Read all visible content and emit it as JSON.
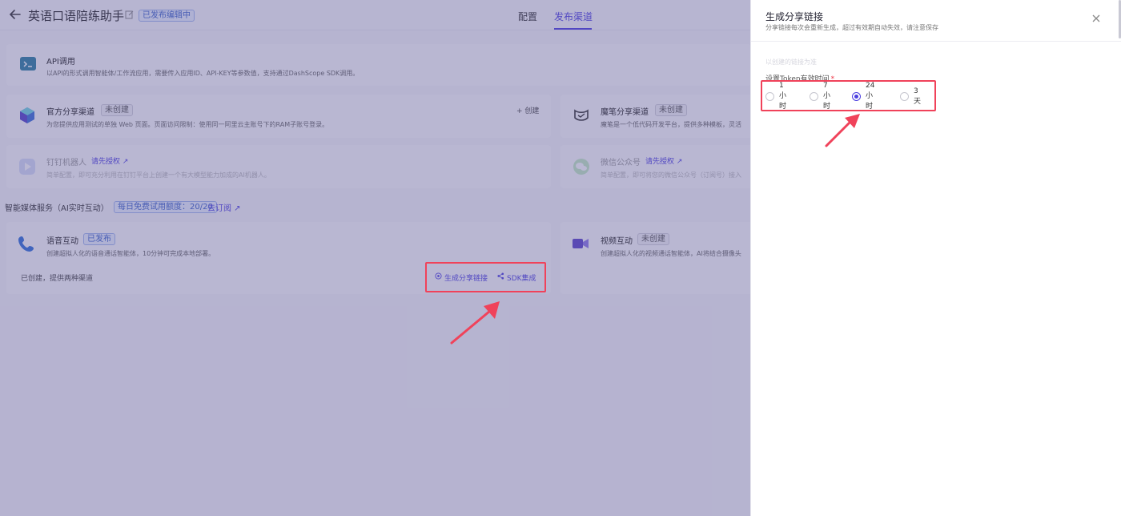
{
  "header": {
    "app_title": "英语口语陪练助手",
    "status": "已发布编辑中",
    "tabs": [
      {
        "label": "配置"
      },
      {
        "label": "发布渠道"
      }
    ]
  },
  "cards": {
    "api": {
      "title": "API调用",
      "desc": "以API的形式调用智能体/工作流应用，需要传入应用ID、API-KEY等参数值，支持通过DashScope SDK调用。"
    },
    "official": {
      "title": "官方分享渠道",
      "badge": "未创建",
      "desc": "为您提供应用测试的单独 Web 页面。页面访问限制：使用同一阿里云主账号下的RAM子账号登录。",
      "action": "+ 创建"
    },
    "modao": {
      "title": "魔笔分享渠道",
      "badge": "未创建",
      "desc": "魔笔是一个低代码开发平台，提供多种模板，灵活"
    },
    "dingtalk": {
      "title": "钉钉机器人",
      "auth": "请先授权 ↗",
      "desc": "简单配置，即可充分利用在钉钉平台上创建一个有大模型能力加成的AI机器人。"
    },
    "wechat": {
      "title": "微信公众号",
      "auth": "请先授权 ↗",
      "desc": "简单配置，即可将您的微信公众号（订阅号）接入"
    }
  },
  "media_section": {
    "title": "智能媒体服务（AI实时互动）",
    "quota": "每日免费试用额度：20/20",
    "subscribe": "去订阅 ↗"
  },
  "voice": {
    "title": "语音互动",
    "badge": "已发布",
    "desc": "创建超拟人化的语音通话智能体，10分钟可完成本地部署。",
    "footer": "已创建，提供两种渠道",
    "share_link": "生成分享链接",
    "sdk": "SDK集成"
  },
  "video": {
    "title": "视频互动",
    "badge": "未创建",
    "desc": "创建超拟人化的视频通话智能体，AI将结合摄像头"
  },
  "drawer": {
    "title": "生成分享链接",
    "subtitle": "分享链接每次会重新生成，超过有效期自动失效，请注意保存",
    "hint": "以创建的链接为准",
    "field_label": "设置Token有效时间",
    "options": [
      {
        "label": "1小时",
        "checked": false
      },
      {
        "label": "7小时",
        "checked": false
      },
      {
        "label": "24小时",
        "checked": true
      },
      {
        "label": "3天",
        "checked": false
      }
    ]
  },
  "colors": {
    "accent": "#4b3fe0",
    "highlight": "#f0425a"
  }
}
